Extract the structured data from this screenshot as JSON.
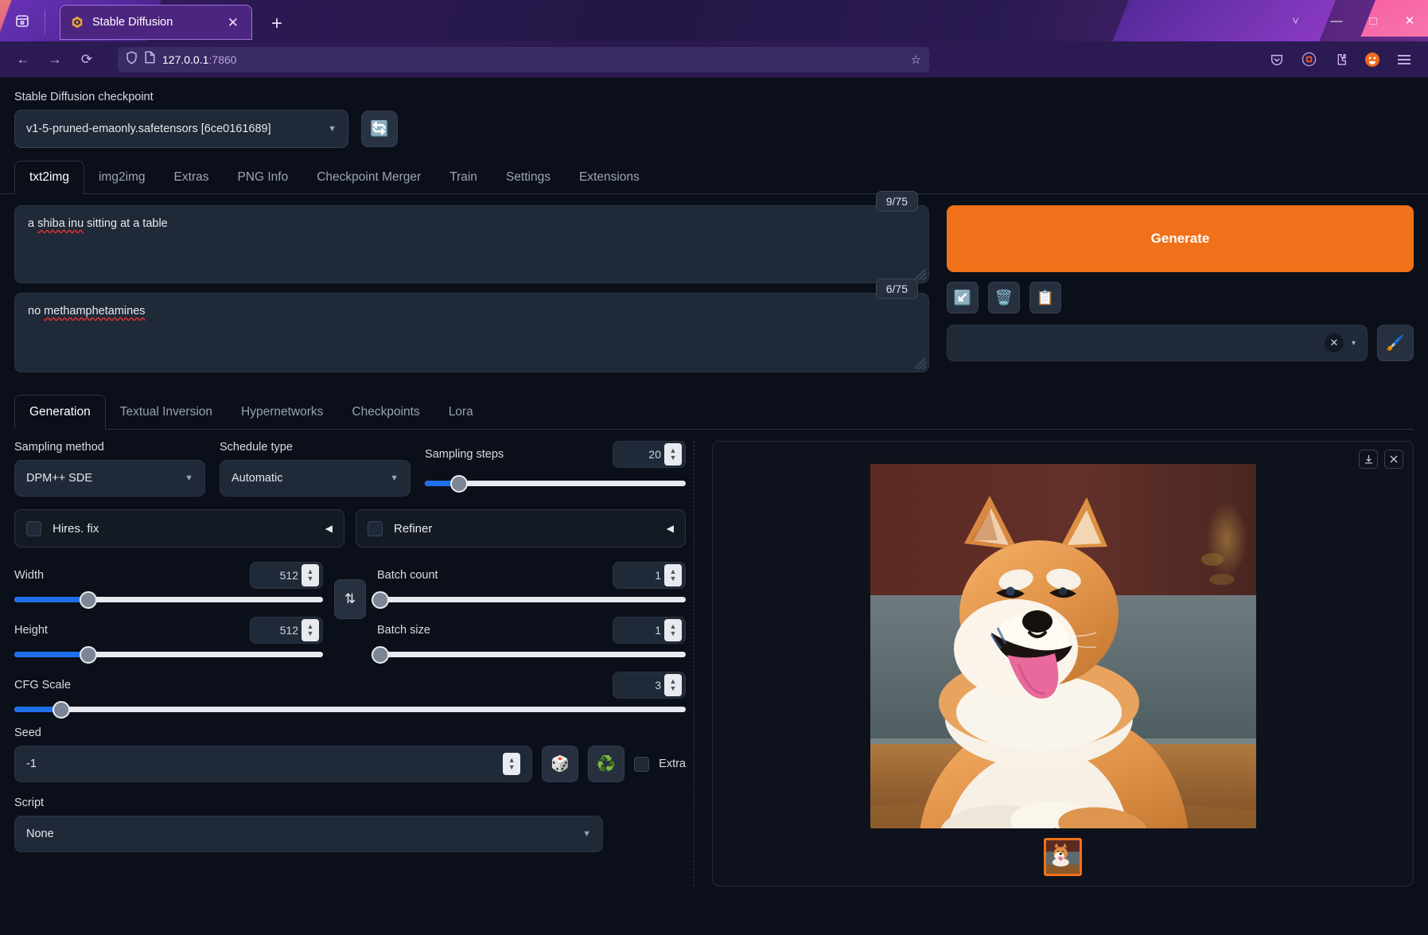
{
  "browser": {
    "tab": {
      "title": "Stable Diffusion",
      "favicon_icon": "stable-diffusion-logo-icon",
      "close_icon": "close-icon"
    },
    "new_tab_icon": "plus-icon",
    "list_all_tabs_icon": "chevron-down-icon",
    "firefox_view_icon": "firefox-view-icon",
    "window_controls": {
      "minimize": "—",
      "maximize": "□",
      "close": "✕"
    },
    "nav": {
      "back_icon": "back-arrow-icon",
      "forward_icon": "forward-arrow-icon",
      "reload_icon": "reload-icon"
    },
    "url": {
      "host": "127.0.0.1",
      "port": ":7860",
      "shield_icon": "shield-icon",
      "page_icon": "page-icon",
      "bookmark_icon": "star-icon"
    },
    "toolbar_icons": [
      "pocket-icon",
      "container-icon",
      "extension-icon",
      "account-avatar-icon",
      "hamburger-menu-icon"
    ]
  },
  "checkpoint": {
    "label": "Stable Diffusion checkpoint",
    "value": "v1-5-pruned-emaonly.safetensors [6ce0161689]",
    "refresh_icon": "🔄"
  },
  "main_tabs": [
    {
      "label": "txt2img",
      "active": true
    },
    {
      "label": "img2img",
      "active": false
    },
    {
      "label": "Extras",
      "active": false
    },
    {
      "label": "PNG Info",
      "active": false
    },
    {
      "label": "Checkpoint Merger",
      "active": false
    },
    {
      "label": "Train",
      "active": false
    },
    {
      "label": "Settings",
      "active": false
    },
    {
      "label": "Extensions",
      "active": false
    }
  ],
  "prompt": {
    "positive": {
      "text": "a shiba inu sitting at a table",
      "spell_words": "shiba inu",
      "token_count": "9/75"
    },
    "negative": {
      "text": "no methamphetamines",
      "spell_words": "methamphetamines",
      "token_count": "6/75"
    }
  },
  "actions": {
    "generate_label": "Generate",
    "tools": [
      {
        "icon": "↙️",
        "name": "restore-progress-button"
      },
      {
        "icon": "🗑️",
        "name": "clear-prompt-button"
      },
      {
        "icon": "📋",
        "name": "paste-button"
      }
    ],
    "styles": {
      "value": "",
      "clear_icon": "✕",
      "caret_icon": "▾"
    },
    "brush_icon": "🖌️"
  },
  "sub_tabs": [
    {
      "label": "Generation",
      "active": true
    },
    {
      "label": "Textual Inversion",
      "active": false
    },
    {
      "label": "Hypernetworks",
      "active": false
    },
    {
      "label": "Checkpoints",
      "active": false
    },
    {
      "label": "Lora",
      "active": false
    }
  ],
  "settings": {
    "sampling_method": {
      "label": "Sampling method",
      "value": "DPM++ SDE"
    },
    "schedule_type": {
      "label": "Schedule type",
      "value": "Automatic"
    },
    "sampling_steps": {
      "label": "Sampling steps",
      "value": "20",
      "percent": 13
    },
    "hires_fix": {
      "label": "Hires. fix",
      "checked": false,
      "arrow": "◀"
    },
    "refiner": {
      "label": "Refiner",
      "checked": false,
      "arrow": "◀"
    },
    "width": {
      "label": "Width",
      "value": "512",
      "percent": 24
    },
    "height": {
      "label": "Height",
      "value": "512",
      "percent": 24
    },
    "batch_count": {
      "label": "Batch count",
      "value": "1",
      "percent": 1
    },
    "batch_size": {
      "label": "Batch size",
      "value": "1",
      "percent": 1
    },
    "swap_icon": "⇅",
    "cfg_scale": {
      "label": "CFG Scale",
      "value": "3",
      "percent": 13
    },
    "seed": {
      "label": "Seed",
      "value": "-1",
      "random_icon": "🎲",
      "recycle_icon": "♻️",
      "extra_label": "Extra",
      "extra_checked": false
    },
    "script": {
      "label": "Script",
      "value": "None"
    }
  },
  "result": {
    "download_icon": "⬇",
    "close_icon": "✕",
    "image_alt": "generated-shiba-inu-image",
    "thumbnail_alt": "result-thumbnail-shiba-inu"
  },
  "colors": {
    "accent_orange": "#f0711a",
    "slider_blue": "#1f6feb",
    "panel_bg": "#1f2937",
    "page_bg": "#0b0f19"
  }
}
